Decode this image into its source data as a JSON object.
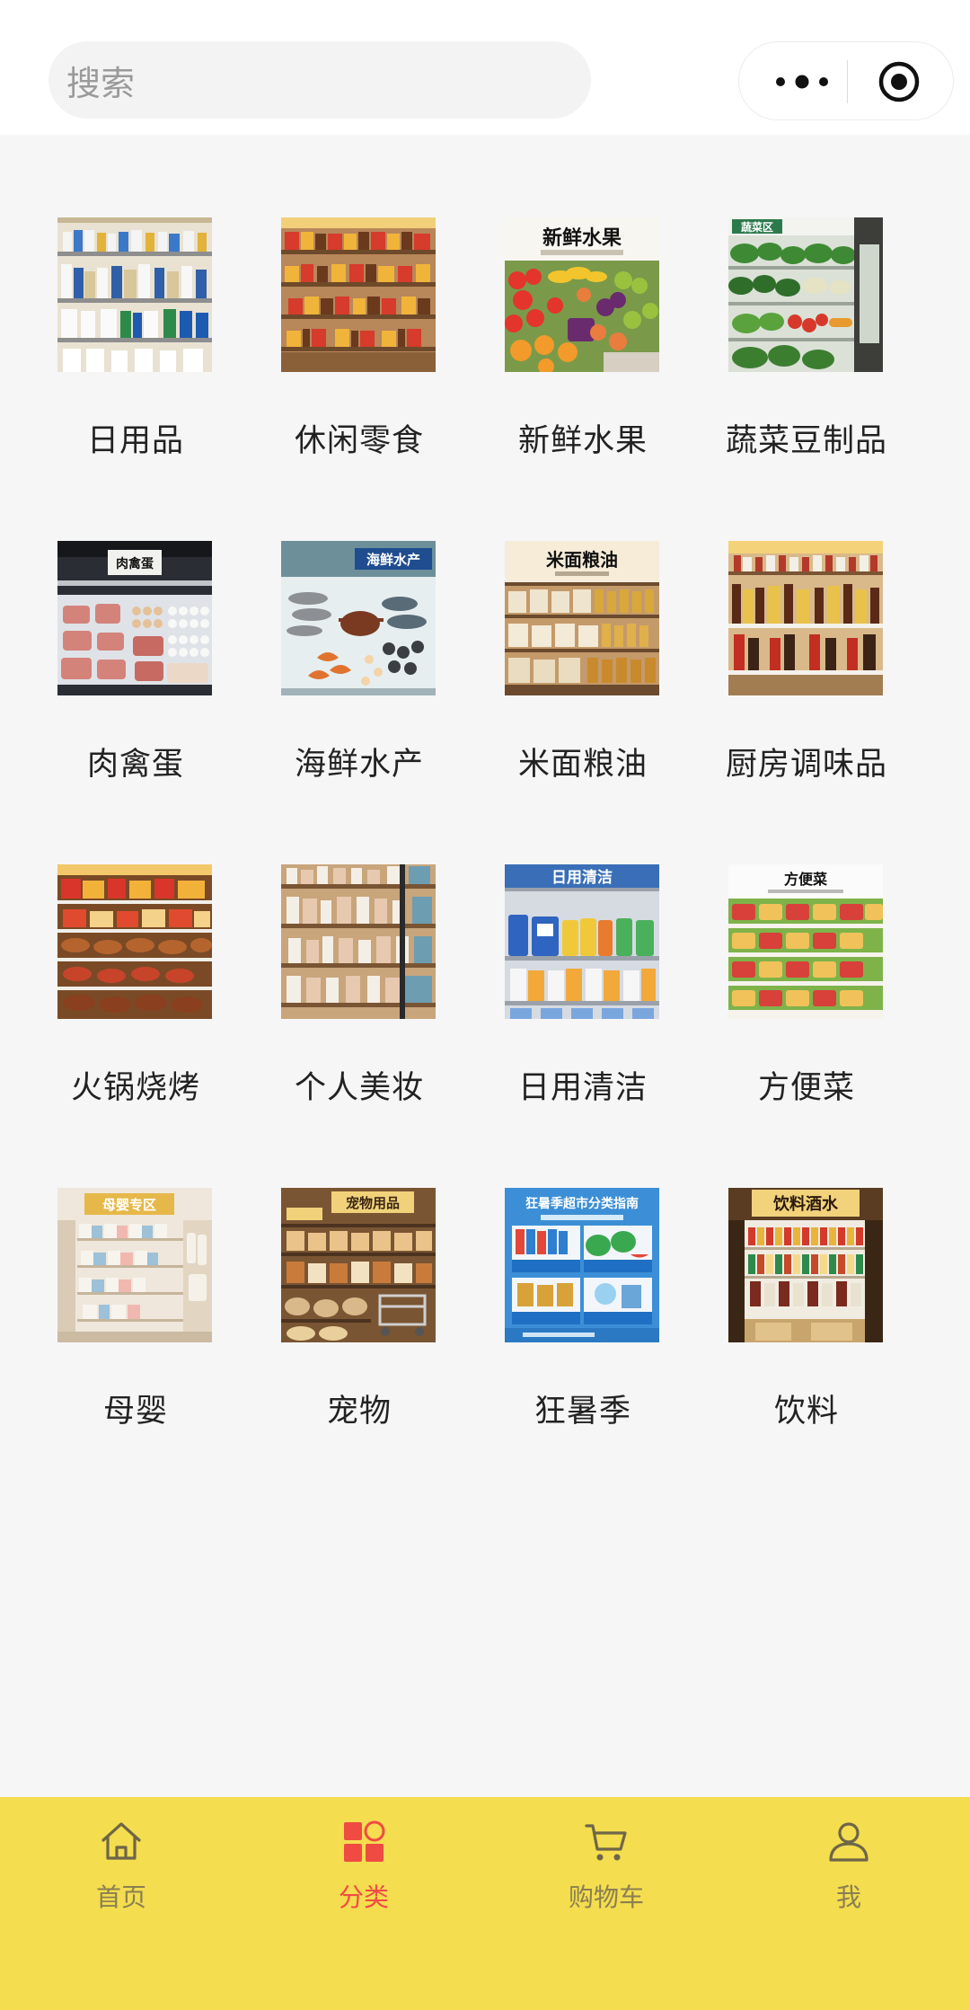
{
  "header": {
    "search_placeholder": "搜索",
    "more_icon": "more-dots-icon",
    "capsule_icon": "target-icon"
  },
  "categories": [
    {
      "label": "日用品",
      "image": "daily-goods-shelf"
    },
    {
      "label": "休闲零食",
      "image": "snacks-shelf"
    },
    {
      "label": "新鲜水果",
      "image": "fresh-fruit-display",
      "sign": "新鲜水果"
    },
    {
      "label": "蔬菜豆制品",
      "image": "vegetable-cooler",
      "sign": "蔬菜区"
    },
    {
      "label": "肉禽蛋",
      "image": "meat-poultry-egg-counter",
      "sign": "肉禽蛋"
    },
    {
      "label": "海鲜水产",
      "image": "seafood-ice-display",
      "sign": "海鲜水产"
    },
    {
      "label": "米面粮油",
      "image": "rice-flour-oil-shelf",
      "sign": "米面粮油"
    },
    {
      "label": "厨房调味品",
      "image": "seasoning-shelf"
    },
    {
      "label": "火锅烧烤",
      "image": "hotpot-bbq-shelf"
    },
    {
      "label": "个人美妆",
      "image": "beauty-shelf"
    },
    {
      "label": "日用清洁",
      "image": "cleaning-shelf",
      "sign": "日用清洁"
    },
    {
      "label": "方便菜",
      "image": "ready-meal-cooler",
      "sign": "方便菜"
    },
    {
      "label": "母婴",
      "image": "mother-baby-shelf",
      "sign": "母婴专区"
    },
    {
      "label": "宠物",
      "image": "pet-supplies-shelf",
      "sign": "宠物用品"
    },
    {
      "label": "狂暑季",
      "image": "summer-guide-poster",
      "sign": "狂暑季超市分类指南"
    },
    {
      "label": "饮料",
      "image": "drinks-shelf",
      "sign": "饮料酒水"
    }
  ],
  "tabbar": {
    "items": [
      {
        "label": "首页",
        "icon": "home-icon",
        "active": false
      },
      {
        "label": "分类",
        "icon": "category-icon",
        "active": true
      },
      {
        "label": "购物车",
        "icon": "cart-icon",
        "active": false
      },
      {
        "label": "我",
        "icon": "user-icon",
        "active": false
      }
    ]
  },
  "colors": {
    "tabbar_bg": "#f4dd4f",
    "active": "#ef4b43",
    "inactive": "#8a7f52",
    "page_bg": "#f6f6f6"
  }
}
